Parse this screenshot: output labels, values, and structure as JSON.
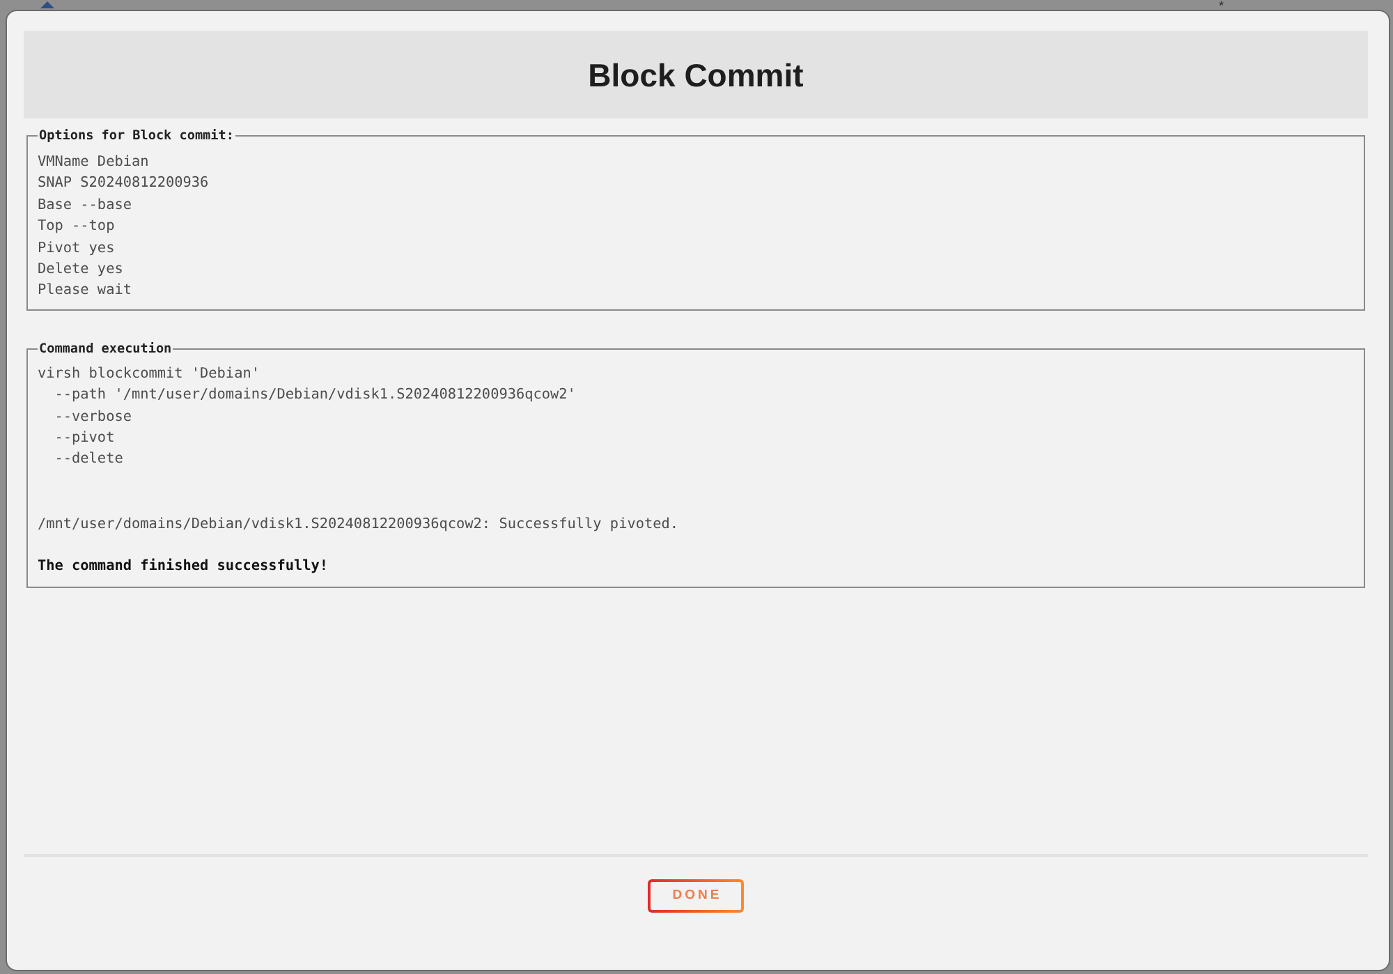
{
  "background_table": {
    "header_mark": "*"
  },
  "dialog": {
    "title": "Block Commit",
    "options": {
      "legend": "Options for Block commit:",
      "lines": [
        "VMName Debian",
        "SNAP S20240812200936",
        "Base --base",
        "Top --top",
        "Pivot yes",
        "Delete yes",
        "Please wait"
      ]
    },
    "command_execution": {
      "legend": "Command execution",
      "command": "virsh blockcommit 'Debian'",
      "arguments": [
        "--path '/mnt/user/domains/Debian/vdisk1.S20240812200936qcow2'",
        "--verbose",
        "--pivot",
        "--delete"
      ],
      "output": "/mnt/user/domains/Debian/vdisk1.S20240812200936qcow2: Successfully pivoted.",
      "result": "The command finished successfully!"
    },
    "done_button": "DONE"
  }
}
